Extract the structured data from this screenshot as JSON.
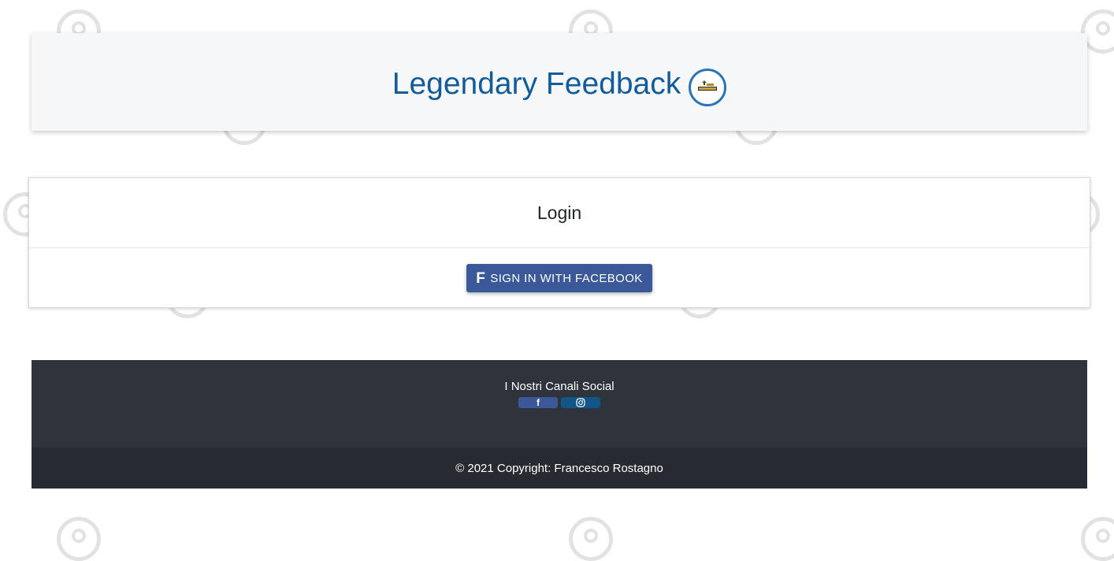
{
  "header": {
    "title": "Legendary Feedback",
    "logo_icon": "legendary-logo-icon"
  },
  "login": {
    "title": "Login",
    "facebook_button_icon": "facebook-f-icon",
    "facebook_button_label": "SIGN IN WITH FACEBOOK"
  },
  "footer": {
    "social_heading": "I Nostri Canali Social",
    "social_links": [
      {
        "name": "facebook",
        "icon": "facebook-f-icon",
        "color": "#3b5998"
      },
      {
        "name": "instagram",
        "icon": "instagram-icon",
        "color": "#125688"
      }
    ],
    "copyright": "© 2021 Copyright: Francesco Rostagno"
  },
  "colors": {
    "title_blue": "#135c9c",
    "facebook_blue": "#3b5998",
    "instagram_blue": "#125688",
    "footer_dark": "#2f333b",
    "footer_darker": "#272a30",
    "header_bg": "#f6f7f9"
  }
}
